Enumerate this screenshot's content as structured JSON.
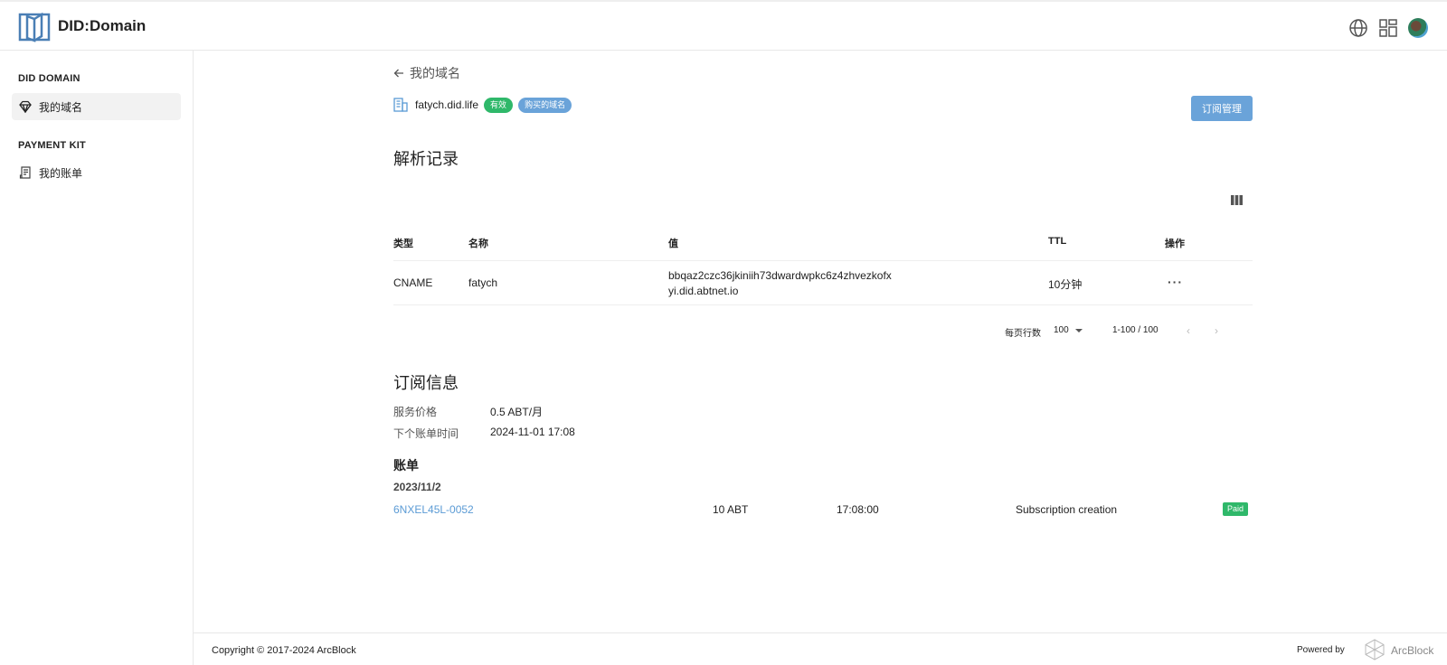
{
  "header": {
    "app_title": "DID:Domain",
    "icons": [
      "globe-icon",
      "apps-icon",
      "avatar"
    ]
  },
  "sidebar": {
    "sections": [
      {
        "title": "DID DOMAIN",
        "items": [
          {
            "label": "我的域名",
            "icon": "diamond-icon",
            "active": true
          }
        ]
      },
      {
        "title": "PAYMENT KIT",
        "items": [
          {
            "label": "我的账单",
            "icon": "receipt-icon",
            "active": false
          }
        ]
      }
    ]
  },
  "page": {
    "back_label": "我的域名",
    "domain": "fatych.did.life",
    "badges": [
      "有效",
      "购买的域名"
    ],
    "subscribe_button": "订阅管理"
  },
  "records": {
    "title": "解析记录",
    "columns": [
      "类型",
      "名称",
      "值",
      "TTL",
      "操作"
    ],
    "rows": [
      {
        "type": "CNAME",
        "name": "fatych",
        "value_line1": "bbqaz2czc36jkiniih73dwardwpkc6z4zhvezkofx",
        "value_line2": "yi.did.abtnet.io",
        "ttl": "10分钟",
        "action": "···"
      }
    ],
    "pagination": {
      "rows_per_page_label": "每页行数",
      "rows_per_page": "100",
      "range": "1-100 / 100"
    }
  },
  "subscription": {
    "title": "订阅信息",
    "price_label": "服务价格",
    "price": "0.5 ABT/月",
    "next_bill_label": "下个账单时间",
    "next_bill": "2024-11-01 17:08"
  },
  "bills": {
    "title": "账单",
    "date": "2023/11/2",
    "items": [
      {
        "id": "6NXEL45L-0052",
        "amount": "10 ABT",
        "time": "17:08:00",
        "desc": "Subscription creation",
        "status": "Paid"
      }
    ]
  },
  "footer": {
    "copyright": "Copyright © 2017-2024  ArcBlock",
    "powered_by": "Powered by",
    "brand": "ArcBlock"
  },
  "colors": {
    "accent": "#6aa3d9",
    "success": "#2fb86a",
    "link": "#5b9bd5"
  }
}
